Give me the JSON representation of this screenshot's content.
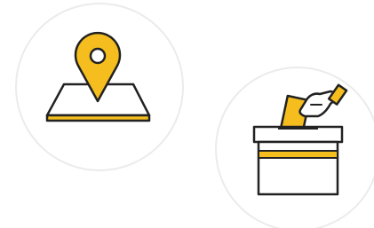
{
  "icons": [
    {
      "name": "map-location-pin-icon"
    },
    {
      "name": "ballot-box-voting-icon"
    }
  ],
  "colors": {
    "accent": "#F5BE1E",
    "outline": "#222222",
    "circle": "#EBEBEB",
    "background": "#FFFFFF"
  }
}
